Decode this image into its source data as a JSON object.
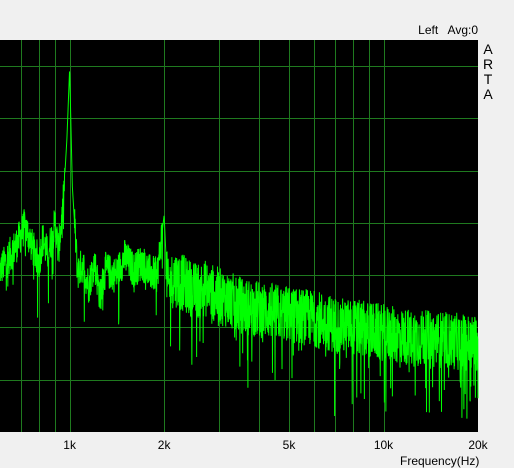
{
  "header": {
    "channel": "Left",
    "averaging": "Avg:0"
  },
  "brand_letters": [
    "A",
    "R",
    "T",
    "A"
  ],
  "colors": {
    "plot_background": "#000000",
    "grid": "#1f7a1f",
    "trace": "#00ff00",
    "panel": "#f0f0f0"
  },
  "chart_data": {
    "type": "line",
    "title": "",
    "xlabel": "Frequency(Hz)",
    "ylabel": "",
    "xscale": "log",
    "xlim": [
      600,
      20000
    ],
    "ylim": [
      0,
      7.5
    ],
    "grid": true,
    "xticks": [
      {
        "value": 1000,
        "label": "1k"
      },
      {
        "value": 2000,
        "label": "2k"
      },
      {
        "value": 5000,
        "label": "5k"
      },
      {
        "value": 10000,
        "label": "10k"
      },
      {
        "value": 20000,
        "label": "20k"
      }
    ],
    "minor_x_gridlines": [
      700,
      800,
      900,
      3000,
      4000,
      6000,
      7000,
      8000,
      9000
    ],
    "y_gridlines": [
      1,
      2,
      3,
      4,
      5,
      6,
      7
    ],
    "series": [
      {
        "x": [
          600,
          640,
          680,
          720,
          760,
          800,
          820,
          850,
          880,
          900,
          920,
          950,
          980,
          1000,
          1020,
          1060,
          1100,
          1150,
          1200,
          1250,
          1300,
          1400,
          1500,
          1600,
          1700,
          1800,
          1900,
          2000,
          2050,
          2150,
          2300,
          2500,
          2700,
          3000,
          3300,
          3600,
          4000,
          4500,
          5000,
          5600,
          6300,
          7000,
          8000,
          9000,
          10000,
          11000,
          12500,
          14000,
          16000,
          18000,
          20000
        ],
        "y": [
          3.1,
          3.35,
          3.6,
          3.95,
          3.55,
          3.25,
          3.7,
          3.4,
          3.75,
          4.0,
          3.45,
          4.2,
          5.6,
          6.95,
          4.7,
          3.05,
          3.2,
          2.8,
          3.25,
          2.6,
          3.1,
          3.0,
          3.35,
          3.1,
          3.25,
          3.05,
          3.0,
          4.15,
          2.75,
          2.95,
          2.85,
          2.7,
          2.75,
          2.6,
          2.5,
          2.4,
          2.35,
          2.3,
          2.25,
          2.2,
          2.15,
          2.05,
          2.0,
          1.95,
          1.9,
          1.85,
          1.8,
          1.78,
          1.75,
          1.72,
          1.7
        ]
      }
    ]
  }
}
